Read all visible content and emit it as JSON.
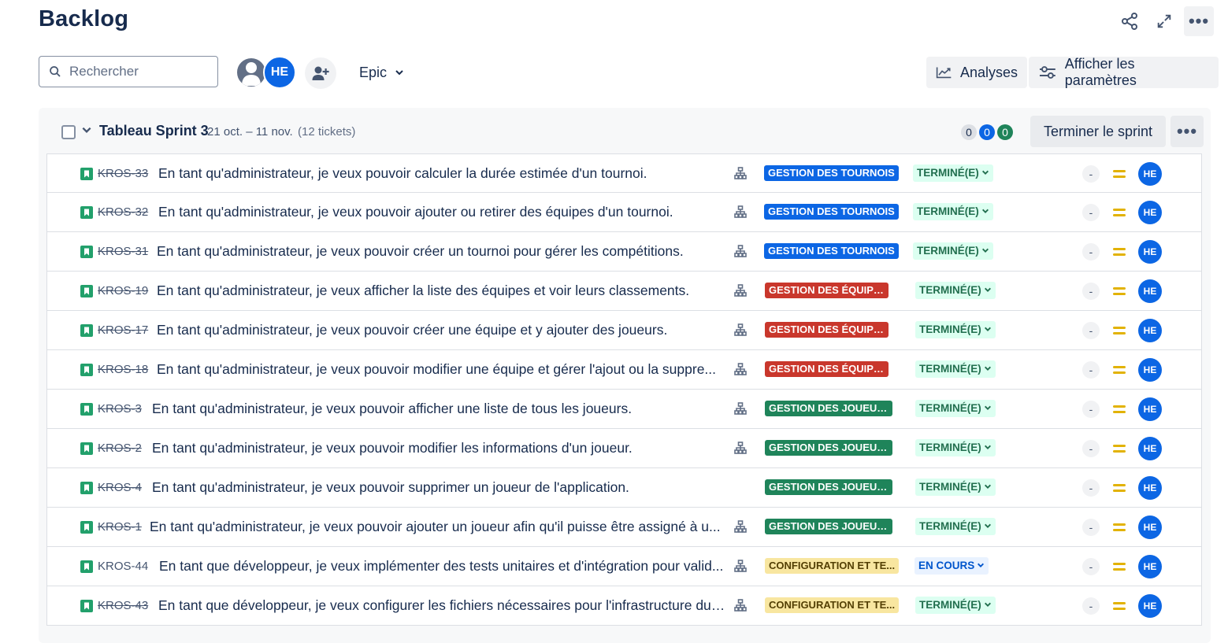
{
  "header": {
    "title": "Backlog"
  },
  "toolbar": {
    "search_placeholder": "Rechercher",
    "avatar_initials": "HE",
    "epic_label": "Epic",
    "analyses_label": "Analyses",
    "params_label": "Afficher les paramètres"
  },
  "sprint": {
    "name": "Tableau Sprint 3",
    "dates": "21 oct. – 11 nov.",
    "ticket_count": "(12 tickets)",
    "counts": {
      "todo": "0",
      "in_progress": "0",
      "done": "0"
    },
    "end_button": "Terminer le sprint"
  },
  "colors": {
    "tournois": "#0c66e4",
    "equipes": "#c9372c",
    "joueurs": "#1f845a",
    "configuration": "#f8e6a0",
    "done_status": "#dcfff1",
    "progress_status": "#e9f2ff"
  },
  "issues": [
    {
      "key": "KROS-33",
      "done": true,
      "summary": "En tant qu'administrateur, je veux pouvoir calculer la durée estimée d'un tournoi.",
      "has_child": true,
      "epic": "GESTION DES TOURNOIS",
      "epic_type": "tournois",
      "status": "TERMINÉ(E)",
      "status_type": "done",
      "estimate": "-",
      "assignee": "HE"
    },
    {
      "key": "KROS-32",
      "done": true,
      "summary": "En tant qu'administrateur, je veux pouvoir ajouter ou retirer des équipes d'un tournoi.",
      "has_child": true,
      "epic": "GESTION DES TOURNOIS",
      "epic_type": "tournois",
      "status": "TERMINÉ(E)",
      "status_type": "done",
      "estimate": "-",
      "assignee": "HE"
    },
    {
      "key": "KROS-31",
      "done": true,
      "summary": "En tant qu'administrateur, je veux pouvoir créer un tournoi pour gérer les compétitions.",
      "has_child": true,
      "epic": "GESTION DES TOURNOIS",
      "epic_type": "tournois",
      "status": "TERMINÉ(E)",
      "status_type": "done",
      "estimate": "-",
      "assignee": "HE"
    },
    {
      "key": "KROS-19",
      "done": true,
      "summary": "En tant qu'administrateur, je veux afficher la liste des équipes et voir leurs classements.",
      "has_child": true,
      "epic": "GESTION DES ÉQUIPES",
      "epic_type": "equipes",
      "status": "TERMINÉ(E)",
      "status_type": "done",
      "estimate": "-",
      "assignee": "HE"
    },
    {
      "key": "KROS-17",
      "done": true,
      "summary": "En tant qu'administrateur, je veux pouvoir créer une équipe et y ajouter des joueurs.",
      "has_child": true,
      "epic": "GESTION DES ÉQUIPES",
      "epic_type": "equipes",
      "status": "TERMINÉ(E)",
      "status_type": "done",
      "estimate": "-",
      "assignee": "HE"
    },
    {
      "key": "KROS-18",
      "done": true,
      "summary": "En tant qu'administrateur, je veux pouvoir modifier une équipe et gérer l'ajout ou la suppre...",
      "has_child": true,
      "epic": "GESTION DES ÉQUIPES",
      "epic_type": "equipes",
      "status": "TERMINÉ(E)",
      "status_type": "done",
      "estimate": "-",
      "assignee": "HE"
    },
    {
      "key": "KROS-3",
      "done": true,
      "summary": "En tant qu'administrateur, je veux pouvoir afficher une liste de tous les joueurs.",
      "has_child": true,
      "epic": "GESTION DES JOUEURS",
      "epic_type": "joueurs",
      "status": "TERMINÉ(E)",
      "status_type": "done",
      "estimate": "-",
      "assignee": "HE"
    },
    {
      "key": "KROS-2",
      "done": true,
      "summary": "En tant qu'administrateur, je veux pouvoir modifier les informations d'un joueur.",
      "has_child": true,
      "epic": "GESTION DES JOUEURS",
      "epic_type": "joueurs",
      "status": "TERMINÉ(E)",
      "status_type": "done",
      "estimate": "-",
      "assignee": "HE"
    },
    {
      "key": "KROS-4",
      "done": true,
      "summary": "En tant qu'administrateur, je veux pouvoir supprimer un joueur de l'application.",
      "has_child": false,
      "epic": "GESTION DES JOUEURS",
      "epic_type": "joueurs",
      "status": "TERMINÉ(E)",
      "status_type": "done",
      "estimate": "-",
      "assignee": "HE"
    },
    {
      "key": "KROS-1",
      "done": true,
      "summary": "En tant qu'administrateur, je veux pouvoir ajouter un joueur afin qu'il puisse être assigné à u...",
      "has_child": true,
      "epic": "GESTION DES JOUEURS",
      "epic_type": "joueurs",
      "status": "TERMINÉ(E)",
      "status_type": "done",
      "estimate": "-",
      "assignee": "HE"
    },
    {
      "key": "KROS-44",
      "done": false,
      "summary": "En tant que développeur, je veux implémenter des tests unitaires et d'intégration pour valid...",
      "has_child": true,
      "epic": "CONFIGURATION ET TE...",
      "epic_type": "configuration",
      "status": "EN COURS",
      "status_type": "prog",
      "estimate": "-",
      "assignee": "HE"
    },
    {
      "key": "KROS-43",
      "done": true,
      "summary": "En tant que développeur, je veux configurer les fichiers nécessaires pour l'infrastructure du ...",
      "has_child": true,
      "epic": "CONFIGURATION ET TE...",
      "epic_type": "configuration",
      "status": "TERMINÉ(E)",
      "status_type": "done",
      "estimate": "-",
      "assignee": "HE"
    }
  ]
}
